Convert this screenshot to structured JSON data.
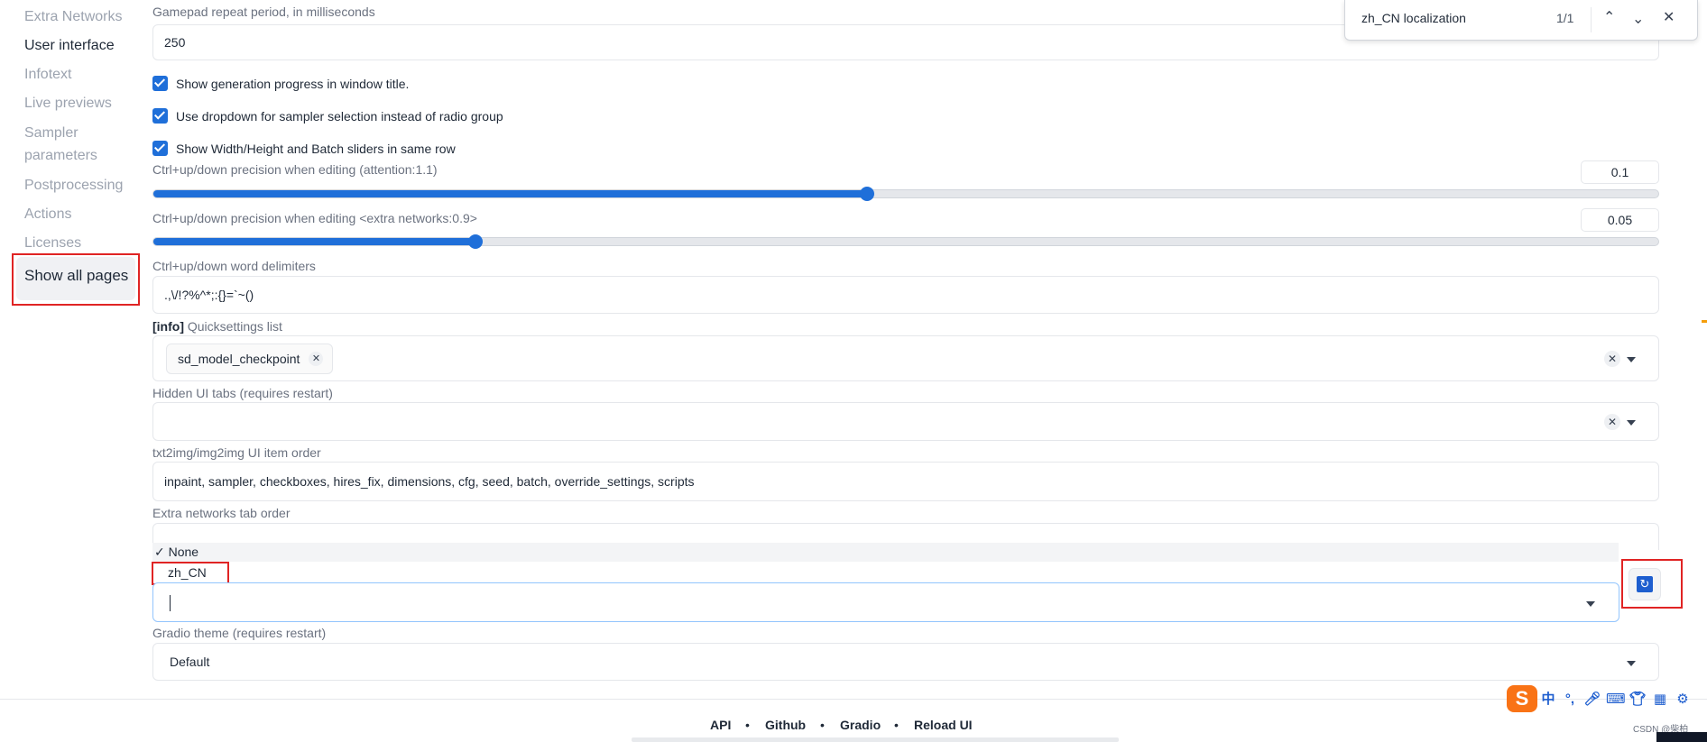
{
  "sidebar": {
    "items": [
      "Extra Networks",
      "User interface",
      "Infotext",
      "Live previews",
      "Sampler\nparameters",
      "Postprocessing",
      "Actions",
      "Licenses"
    ],
    "show_all": "Show all pages"
  },
  "settings": {
    "gamepad_label": "Gamepad repeat period, in milliseconds",
    "gamepad_value": "250",
    "checks": [
      "Show generation progress in window title.",
      "Use dropdown for sampler selection instead of radio group",
      "Show Width/Height and Batch sliders in same row"
    ],
    "attention_label": "Ctrl+up/down precision when editing (attention:1.1)",
    "attention_value": "0.1",
    "attention_fraction": 0.474,
    "extra_label": "Ctrl+up/down precision when editing <extra networks:0.9>",
    "extra_value": "0.05",
    "extra_fraction": 0.214,
    "delimiters_label": "Ctrl+up/down word delimiters",
    "delimiters_value": ".,\\/!?%^*;:{}=`~()",
    "quick_info": "[info]",
    "quick_label": "Quicksettings list",
    "quick_chip": "sd_model_checkpoint",
    "hidden_label": "Hidden UI tabs (requires restart)",
    "order_label": "txt2img/img2img UI item order",
    "order_value": "inpaint, sampler, checkboxes, hires_fix, dimensions, cfg, seed, batch, override_settings, scripts",
    "tab_order_label": "Extra networks tab order",
    "dropdown_options": [
      "✓ None",
      "zh_CN"
    ],
    "theme_label": "Gradio theme (requires restart)",
    "theme_value": "Default"
  },
  "findbar": {
    "query": "zh_CN localization",
    "count": "1/1"
  },
  "footer": {
    "links": [
      "API",
      "Github",
      "Gradio",
      "Reload UI"
    ],
    "watermark": "CSDN @柴柏"
  },
  "tray": {
    "ime_char": "中",
    "punct": "°,"
  },
  "colors": {
    "accent": "#1f6fd9",
    "highlight": "#e02424"
  }
}
